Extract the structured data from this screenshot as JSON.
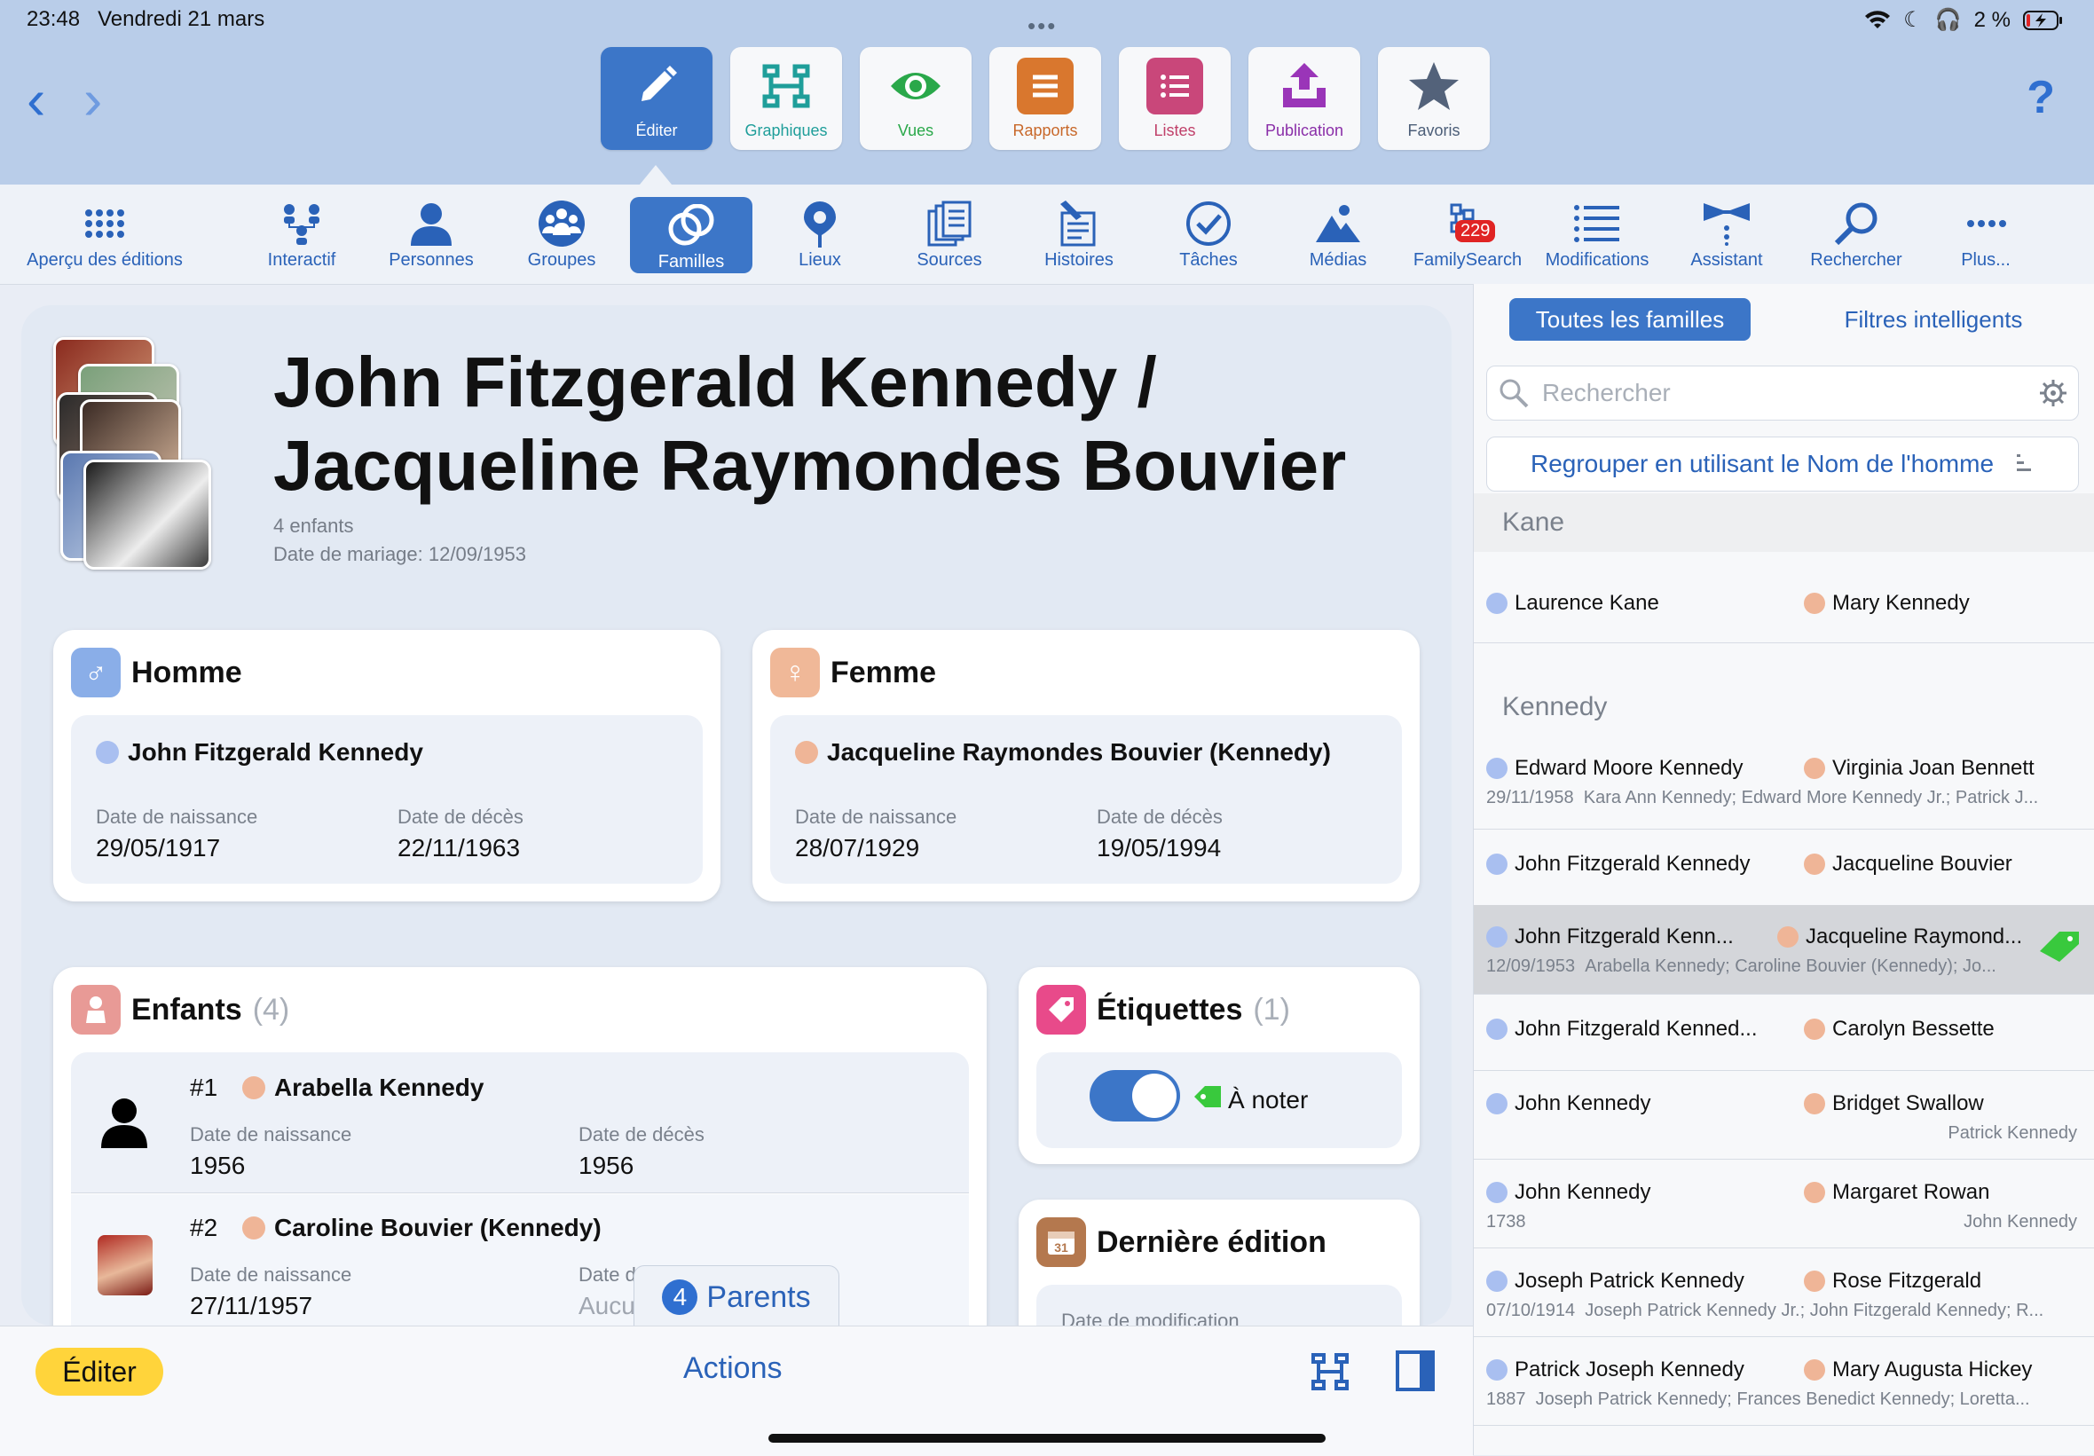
{
  "status": {
    "time": "23:48",
    "date": "Vendredi 21 mars",
    "battery": "2 %"
  },
  "modes": [
    {
      "label": "Éditer",
      "icon": "pencil-icon",
      "color": "#ffffff"
    },
    {
      "label": "Graphiques",
      "icon": "chart-icon",
      "color": "#1f9e9a"
    },
    {
      "label": "Vues",
      "icon": "eye-icon",
      "color": "#2aa84a"
    },
    {
      "label": "Rapports",
      "icon": "report-icon",
      "color": "#c8682a"
    },
    {
      "label": "Listes",
      "icon": "list-icon",
      "color": "#c0406a"
    },
    {
      "label": "Publication",
      "icon": "upload-icon",
      "color": "#8a2ea8"
    },
    {
      "label": "Favoris",
      "icon": "star-icon",
      "color": "#4c5e78"
    }
  ],
  "sections": [
    {
      "label": "Aperçu des éditions"
    },
    {
      "label": "Interactif"
    },
    {
      "label": "Personnes"
    },
    {
      "label": "Groupes"
    },
    {
      "label": "Familles"
    },
    {
      "label": "Lieux"
    },
    {
      "label": "Sources"
    },
    {
      "label": "Histoires"
    },
    {
      "label": "Tâches"
    },
    {
      "label": "Médias"
    },
    {
      "label": "FamilySearch",
      "badge": "229"
    },
    {
      "label": "Modifications"
    },
    {
      "label": "Assistant"
    },
    {
      "label": "Rechercher"
    },
    {
      "label": "Plus..."
    }
  ],
  "family": {
    "title_line1": "John Fitzgerald Kennedy /",
    "title_line2": "Jacqueline Raymondes Bouvier",
    "children_count": "4 enfants",
    "marriage": "Date de mariage: 12/09/1953"
  },
  "man": {
    "header": "Homme",
    "name": "John Fitzgerald Kennedy",
    "birth_label": "Date de naissance",
    "birth": "29/05/1917",
    "death_label": "Date de décès",
    "death": "22/11/1963"
  },
  "woman": {
    "header": "Femme",
    "name": "Jacqueline Raymondes Bouvier (Kennedy)",
    "birth_label": "Date de naissance",
    "birth": "28/07/1929",
    "death_label": "Date de décès",
    "death": "19/05/1994"
  },
  "children": {
    "header": "Enfants",
    "count": "(4)",
    "items": [
      {
        "num": "#1",
        "name": "Arabella Kennedy",
        "birth_label": "Date de naissance",
        "birth": "1956",
        "death_label": "Date de décès",
        "death": "1956"
      },
      {
        "num": "#2",
        "name": "Caroline Bouvier (Kennedy)",
        "birth_label": "Date de naissance",
        "birth": "27/11/1957",
        "death_label": "Date d",
        "death": "Aucu"
      }
    ]
  },
  "tags": {
    "header": "Étiquettes",
    "count": "(1)",
    "tag": "À noter",
    "tag_color": "#39c93d"
  },
  "last_edit": {
    "header": "Dernière édition",
    "mod_label": "Date de modification"
  },
  "parents_button": {
    "num": "4",
    "label": "Parents"
  },
  "bottom": {
    "edit": "Éditer",
    "actions": "Actions"
  },
  "sidebar": {
    "seg_all": "Toutes les familles",
    "seg_smart": "Filtres intelligents",
    "search_placeholder": "Rechercher",
    "group_by": "Regrouper en utilisant le Nom de l'homme",
    "sections": [
      {
        "header": "Kane",
        "rows": [
          {
            "man": "Laurence Kane",
            "woman": "Mary Kennedy",
            "date": "",
            "children": "",
            "right": ""
          }
        ]
      },
      {
        "header": "Kennedy",
        "rows": [
          {
            "man": "Edward Moore Kennedy",
            "woman": "Virginia Joan Bennett",
            "date": "29/11/1958",
            "children": "Kara Ann Kennedy; Edward More Kennedy Jr.; Patrick J...",
            "right": ""
          },
          {
            "man": "John Fitzgerald Kennedy",
            "woman": "Jacqueline Bouvier",
            "date": "",
            "children": "",
            "right": ""
          },
          {
            "man": "John Fitzgerald Kenn...",
            "woman": "Jacqueline Raymond...",
            "date": "12/09/1953",
            "children": "Arabella Kennedy; Caroline Bouvier (Kennedy); Jo...",
            "right": "",
            "selected": true
          },
          {
            "man": "John Fitzgerald Kenned...",
            "woman": "Carolyn Bessette",
            "date": "",
            "children": "",
            "right": ""
          },
          {
            "man": "John Kennedy",
            "woman": "Bridget Swallow",
            "date": "",
            "children": "",
            "right": "Patrick Kennedy"
          },
          {
            "man": "John Kennedy",
            "woman": "Margaret Rowan",
            "date": "1738",
            "children": "",
            "right": "John Kennedy"
          },
          {
            "man": "Joseph Patrick Kennedy",
            "woman": "Rose Fitzgerald",
            "date": "07/10/1914",
            "children": "Joseph Patrick Kennedy Jr.; John Fitzgerald Kennedy; R...",
            "right": ""
          },
          {
            "man": "Patrick Joseph Kennedy",
            "woman": "Mary Augusta Hickey",
            "date": "1887",
            "children": "Joseph Patrick Kennedy; Frances Benedict Kennedy; Loretta...",
            "right": ""
          }
        ]
      }
    ]
  }
}
